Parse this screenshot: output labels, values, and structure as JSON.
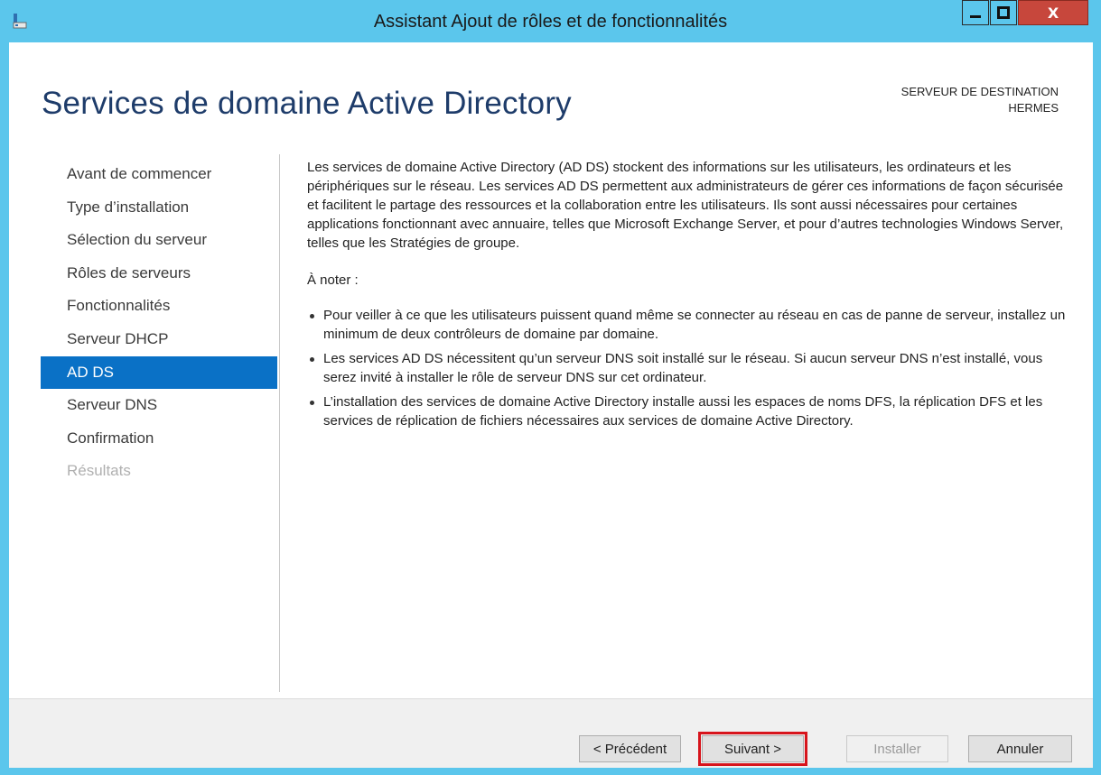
{
  "window": {
    "title": "Assistant Ajout de rôles et de fonctionnalités",
    "close_glyph": "X",
    "accent_color": "#5bc6ec"
  },
  "header": {
    "page_title": "Services de domaine Active Directory",
    "dest_label": "SERVEUR DE DESTINATION",
    "dest_server": "HERMES"
  },
  "nav": {
    "items": [
      {
        "label": "Avant de commencer",
        "state": "normal"
      },
      {
        "label": "Type d’installation",
        "state": "normal"
      },
      {
        "label": "Sélection du serveur",
        "state": "normal"
      },
      {
        "label": "Rôles de serveurs",
        "state": "normal"
      },
      {
        "label": "Fonctionnalités",
        "state": "normal"
      },
      {
        "label": "Serveur DHCP",
        "state": "normal"
      },
      {
        "label": "AD DS",
        "state": "active"
      },
      {
        "label": "Serveur DNS",
        "state": "normal"
      },
      {
        "label": "Confirmation",
        "state": "normal"
      },
      {
        "label": "Résultats",
        "state": "disabled"
      }
    ],
    "active_color": "#0a71c6"
  },
  "main": {
    "intro": "Les services de domaine Active Directory (AD DS) stockent des informations sur les utilisateurs, les ordinateurs et les périphériques sur le réseau. Les services AD DS permettent aux administrateurs de gérer ces informations de façon sécurisée et facilitent le partage des ressources et la collaboration entre les utilisateurs. Ils sont aussi nécessaires pour certaines applications fonctionnant avec annuaire, telles que Microsoft Exchange Server, et pour d’autres technologies Windows Server, telles que les Stratégies de groupe.",
    "note_heading": "À noter :",
    "bullets": [
      "Pour veiller à ce que les utilisateurs puissent quand même se connecter au réseau en cas de panne de serveur, installez un minimum de deux contrôleurs de domaine par domaine.",
      "Les services AD DS nécessitent qu’un serveur DNS soit installé sur le réseau. Si aucun serveur DNS n’est installé, vous serez invité à installer le rôle de serveur DNS sur cet ordinateur.",
      "L’installation des services de domaine Active Directory installe aussi les espaces de noms DFS, la réplication DFS et les services de réplication de fichiers nécessaires aux services de domaine Active Directory."
    ]
  },
  "footer": {
    "prev_label": "< Précédent",
    "next_label": "Suivant >",
    "install_label": "Installer",
    "cancel_label": "Annuler",
    "highlight_color": "#d7141c"
  }
}
